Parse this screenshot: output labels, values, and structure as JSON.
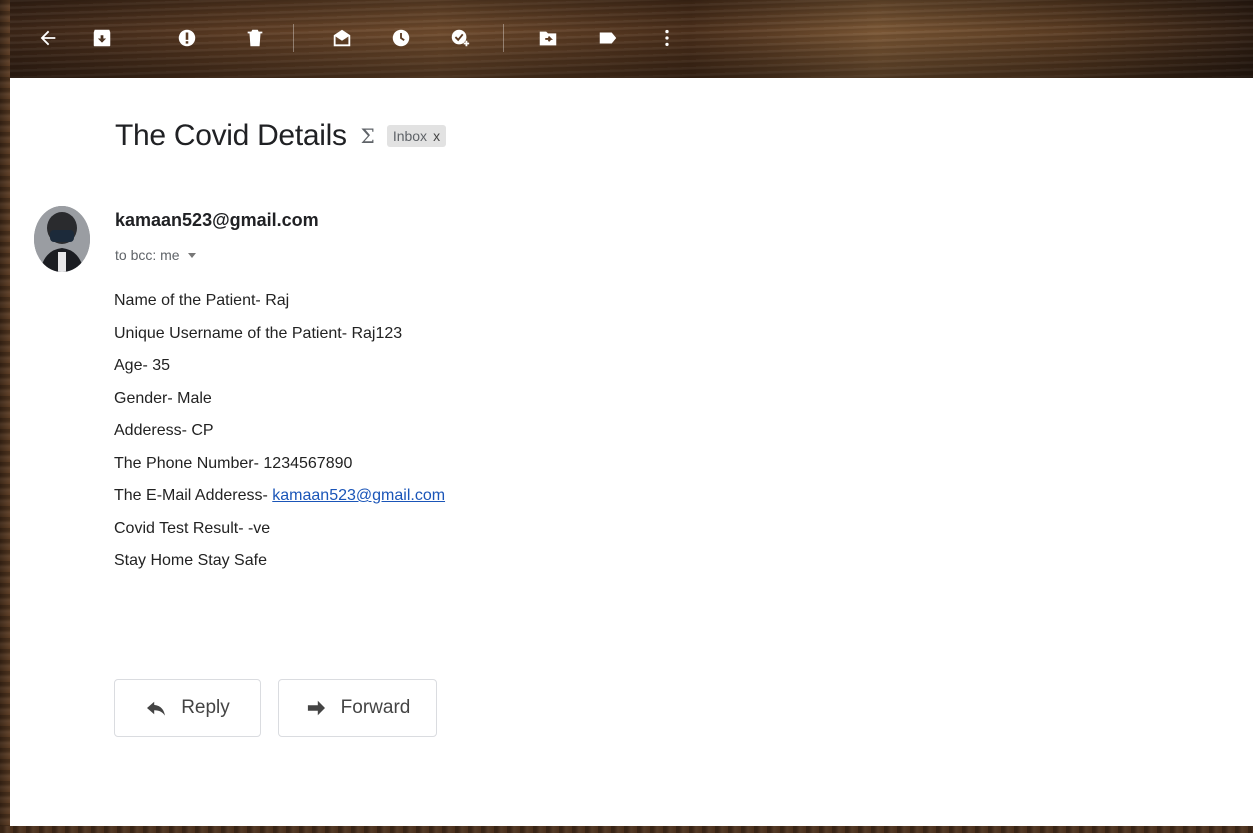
{
  "toolbar": {
    "icons": [
      "back-arrow-icon",
      "archive-icon",
      "report-spam-icon",
      "delete-icon",
      "mark-unread-icon",
      "snooze-icon",
      "add-task-icon",
      "move-to-icon",
      "label-icon",
      "more-icon"
    ]
  },
  "email": {
    "subject": "The Covid Details",
    "importance_marker": "Σ",
    "label": "Inbox",
    "label_remove": "x",
    "sender": "kamaan523@gmail.com",
    "recipient": "to bcc: me",
    "body": {
      "line1": "Name of the Patient- Raj",
      "line2": "Unique Username of the Patient- Raj123",
      "line3": "Age- 35",
      "line4": "Gender- Male",
      "line5": "Adderess- CP",
      "line6": "The Phone Number- 1234567890",
      "line7_prefix": "The E-Mail Adderess- ",
      "line7_link": "kamaan523@gmail.com",
      "line8": "Covid Test Result- -ve",
      "line9": "Stay Home Stay Safe"
    }
  },
  "actions": {
    "reply": "Reply",
    "forward": "Forward"
  },
  "colors": {
    "link": "#1a55b8",
    "text": "#202124",
    "muted": "#5f6368",
    "chip_bg": "#e2e2e2"
  }
}
